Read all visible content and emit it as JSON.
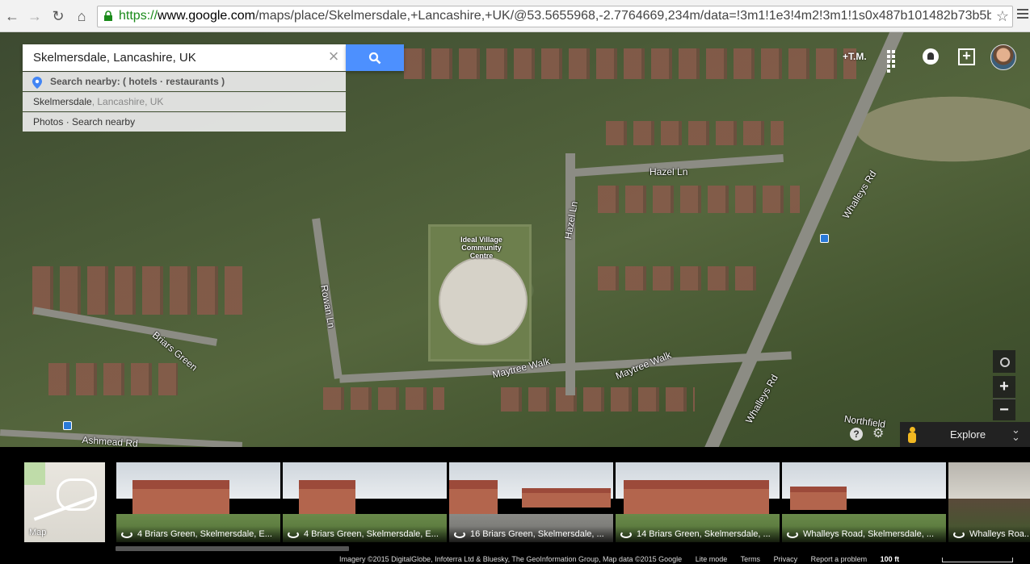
{
  "browser": {
    "url_protocol": "https://",
    "url_host": "www.google.com",
    "url_path": "/maps/place/Skelmersdale,+Lancashire,+UK/@53.5655968,-2.7764669,234m/data=!3m1!1e3!4m2!3m1!1s0x487b101482b73b5b:",
    "back_icon": "arrow-left-icon",
    "forward_icon": "arrow-right-icon",
    "reload_icon": "reload-icon",
    "home_icon": "home-icon"
  },
  "search": {
    "value": "Skelmersdale, Lancashire, UK",
    "clear_glyph": "×",
    "suggestions": [
      {
        "prefix": "Search nearby:",
        "text": " ( hotels · restaurants )"
      },
      {
        "main": "Skelmersdale",
        "secondary": ", Lancashire, UK"
      },
      {
        "text": "Photos · Search nearby"
      }
    ]
  },
  "account": {
    "user_link": "+T.M."
  },
  "map": {
    "place_label": "Ideal Village Community Centre",
    "roads": [
      "Hazel Ln",
      "Hazel Ln",
      "Rowan Ln",
      "Briars Green",
      "Maytree Walk",
      "Maytree Walk",
      "Whalleys Rd",
      "Whalleys Rd",
      "Northfield",
      "Ashmead Rd"
    ],
    "controls": {
      "zoom_in": "+",
      "zoom_out": "−",
      "help": "?",
      "settings_glyph": "⚙",
      "explore": "Explore",
      "explore_chevron": "⌄⌄"
    }
  },
  "filmstrip": {
    "map_label": "Map",
    "photos": [
      {
        "caption": "4 Briars Green, Skelmersdale, E..."
      },
      {
        "caption": "4 Briars Green, Skelmersdale, E..."
      },
      {
        "caption": "16 Briars Green, Skelmersdale, ..."
      },
      {
        "caption": "14 Briars Green, Skelmersdale, ..."
      },
      {
        "caption": "Whalleys Road, Skelmersdale, ..."
      },
      {
        "caption": "Whalleys Roa..."
      }
    ]
  },
  "footer": {
    "attribution": "Imagery ©2015 DigitalGlobe, Infoterra Ltd & Bluesky, The GeoInformation Group, Map data ©2015 Google",
    "lite_mode": "Lite mode",
    "terms": "Terms",
    "privacy": "Privacy",
    "report": "Report a problem",
    "scale": "100 ft"
  }
}
